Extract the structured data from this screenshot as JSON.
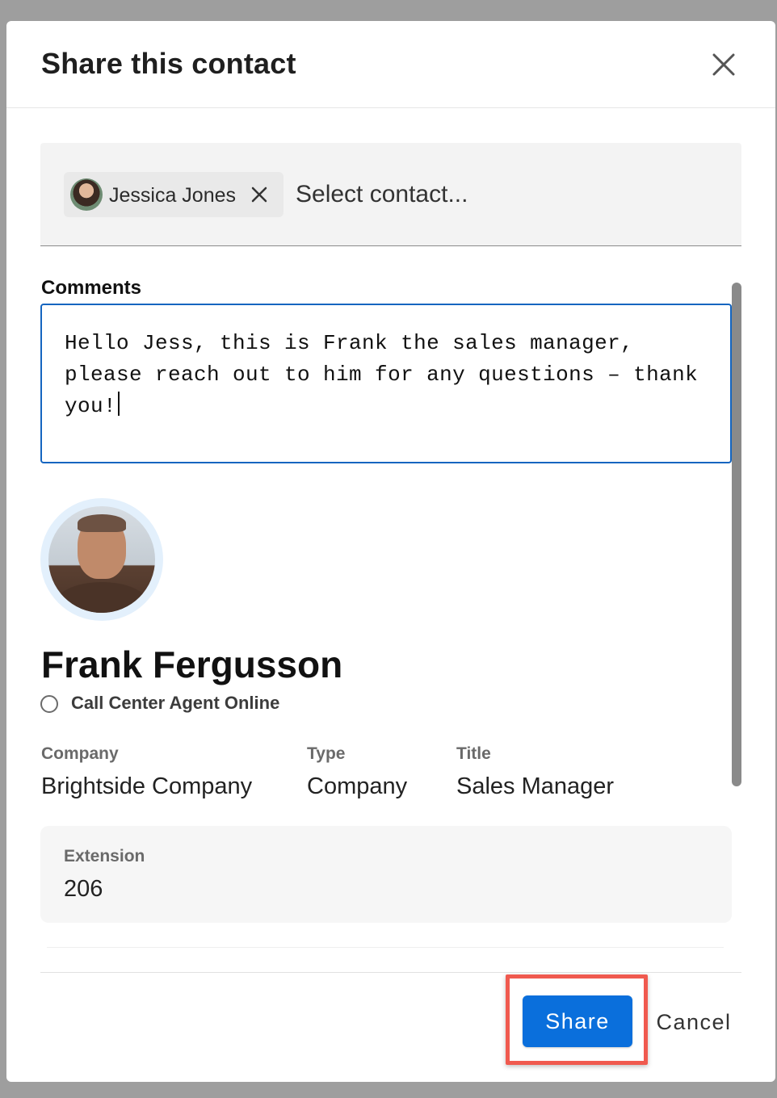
{
  "dialog": {
    "title": "Share this contact",
    "close_icon": "close-icon"
  },
  "picker": {
    "chip_label": "Jessica Jones",
    "chip_remove_icon": "close-icon",
    "placeholder": "Select contact..."
  },
  "comments": {
    "label": "Comments",
    "value": "Hello Jess, this is Frank the sales manager, please reach out to him for any questions – thank you!"
  },
  "contact": {
    "name": "Frank Fergusson",
    "status": "Call Center Agent Online",
    "fields": [
      {
        "label": "Company",
        "value": "Brightside Company"
      },
      {
        "label": "Type",
        "value": "Company"
      },
      {
        "label": "Title",
        "value": "Sales Manager"
      }
    ],
    "extension": {
      "label": "Extension",
      "value": "206"
    }
  },
  "footer": {
    "share_label": "Share",
    "cancel_label": "Cancel"
  },
  "colors": {
    "primary": "#0a6fdc",
    "focus_border": "#1565c0",
    "highlight": "#f05a4f"
  }
}
